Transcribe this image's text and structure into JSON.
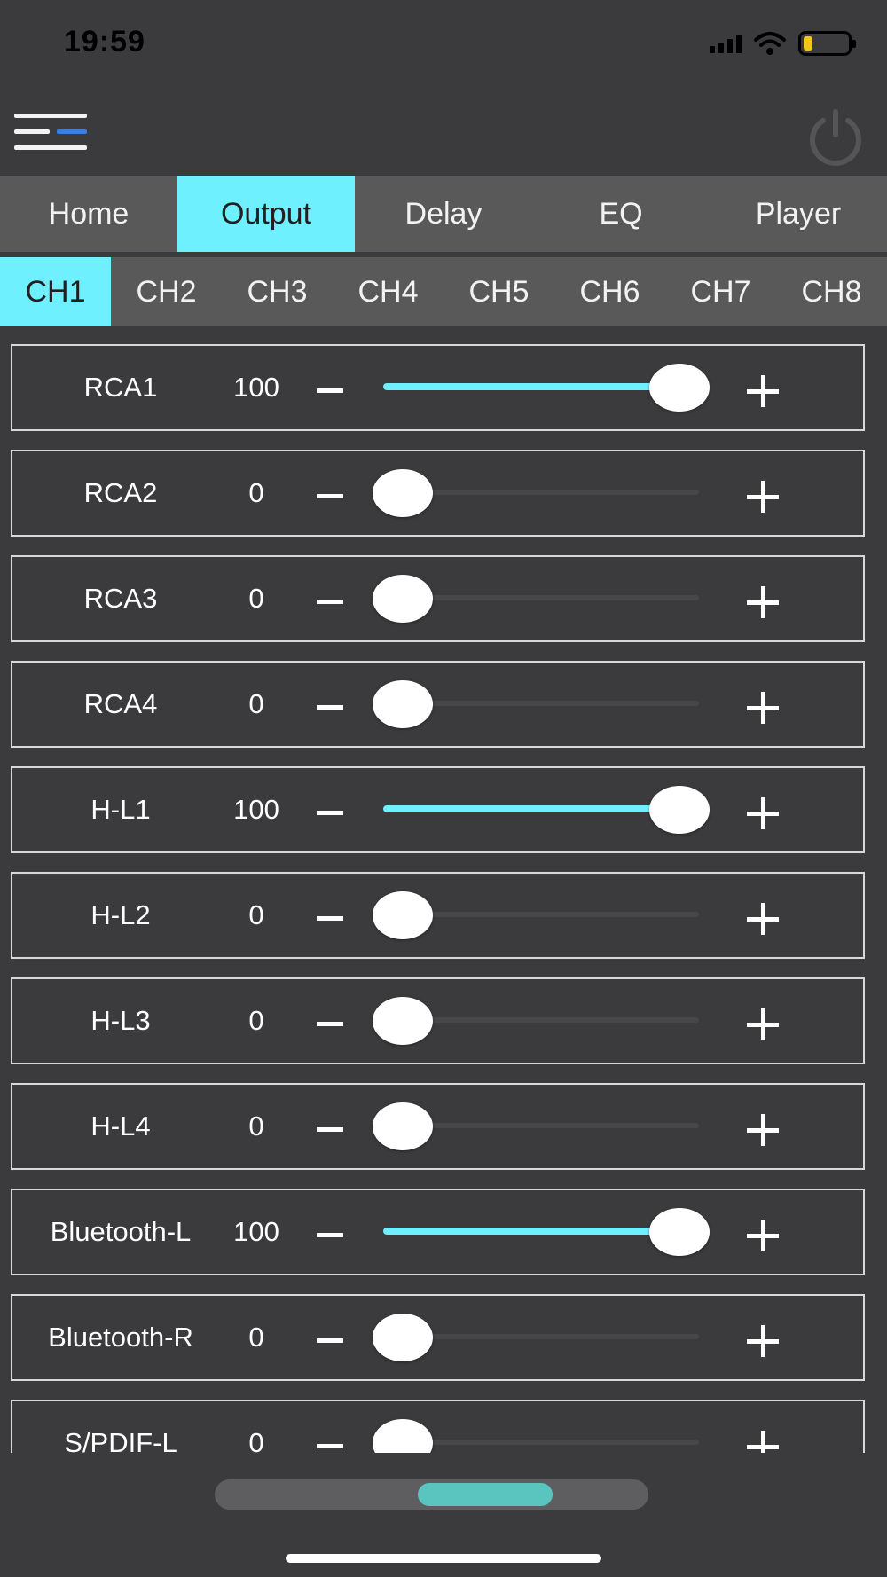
{
  "status_bar": {
    "time": "19:59",
    "battery_level": 0.2,
    "battery_color": "#f2c718"
  },
  "header": {
    "menu_icon": "menu-icon",
    "power_icon": "power-icon",
    "accent_color": "#3c7de0"
  },
  "tabs": [
    {
      "label": "Home",
      "active": false
    },
    {
      "label": "Output",
      "active": true
    },
    {
      "label": "Delay",
      "active": false
    },
    {
      "label": "EQ",
      "active": false
    },
    {
      "label": "Player",
      "active": false
    }
  ],
  "channels": [
    {
      "label": "CH1",
      "active": true
    },
    {
      "label": "CH2",
      "active": false
    },
    {
      "label": "CH3",
      "active": false
    },
    {
      "label": "CH4",
      "active": false
    },
    {
      "label": "CH5",
      "active": false
    },
    {
      "label": "CH6",
      "active": false
    },
    {
      "label": "CH7",
      "active": false
    },
    {
      "label": "CH8",
      "active": false
    }
  ],
  "outputs": [
    {
      "name": "RCA1",
      "value": "100",
      "level": 1
    },
    {
      "name": "RCA2",
      "value": "0",
      "level": 0
    },
    {
      "name": "RCA3",
      "value": "0",
      "level": 0
    },
    {
      "name": "RCA4",
      "value": "0",
      "level": 0
    },
    {
      "name": "H-L1",
      "value": "100",
      "level": 1
    },
    {
      "name": "H-L2",
      "value": "0",
      "level": 0
    },
    {
      "name": "H-L3",
      "value": "0",
      "level": 0
    },
    {
      "name": "H-L4",
      "value": "0",
      "level": 0
    },
    {
      "name": "Bluetooth-L",
      "value": "100",
      "level": 1
    },
    {
      "name": "Bluetooth-R",
      "value": "0",
      "level": 0
    },
    {
      "name": "S/PDIF-L",
      "value": "0",
      "level": 0
    }
  ],
  "page_scroller": {
    "position": 0.68
  },
  "colors": {
    "accent": "#6ef0ff",
    "background": "#3b3b3d",
    "tab_bar": "#595959",
    "scroller_thumb": "#5ac4bf"
  }
}
